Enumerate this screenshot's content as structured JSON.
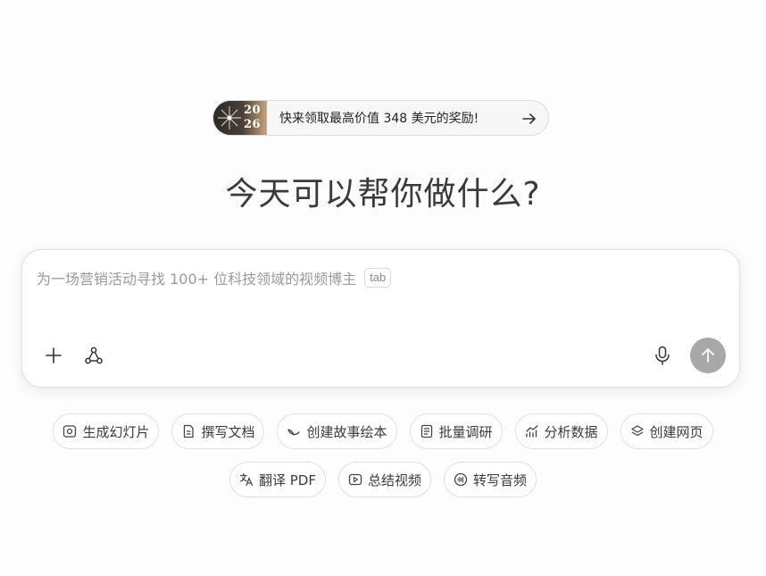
{
  "promo": {
    "year_top": "20",
    "year_bottom": "26",
    "text": "快来领取最高价值 348 美元的奖励!"
  },
  "heading": "今天可以帮你做什么?",
  "composer": {
    "placeholder": "为一场营销活动寻找 100+ 位科技领域的视频博主",
    "tab_hint": "tab"
  },
  "chips_row1": [
    {
      "label": "生成幻灯片",
      "icon": "slides-icon"
    },
    {
      "label": "撰写文档",
      "icon": "document-icon"
    },
    {
      "label": "创建故事绘本",
      "icon": "storybook-icon"
    },
    {
      "label": "批量调研",
      "icon": "research-icon"
    },
    {
      "label": "分析数据",
      "icon": "chart-icon"
    },
    {
      "label": "创建网页",
      "icon": "layers-icon"
    }
  ],
  "chips_row2": [
    {
      "label": "翻译 PDF",
      "icon": "translate-icon"
    },
    {
      "label": "总结视频",
      "icon": "video-icon"
    },
    {
      "label": "转写音频",
      "icon": "audio-icon"
    }
  ],
  "colors": {
    "send_button": "#a8a8a8",
    "chip_border": "#e0e0e0"
  }
}
